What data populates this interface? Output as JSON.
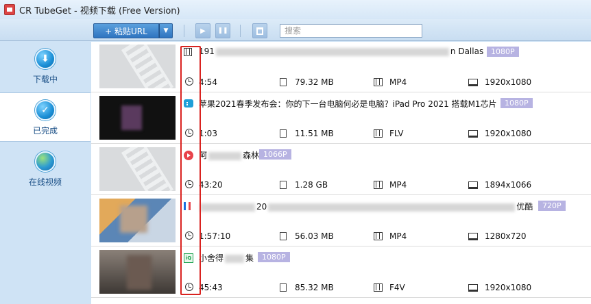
{
  "window": {
    "title": "CR TubeGet - 视频下载 (Free Version)"
  },
  "toolbar": {
    "paste_label": "+ 粘贴URL",
    "dropdown_glyph": "▼",
    "play_glyph": "▶",
    "pause_glyph": "❚❚",
    "search_placeholder": "搜索"
  },
  "sidebar": {
    "items": [
      {
        "label": "下载中",
        "icon": "download-icon"
      },
      {
        "label": "已完成",
        "icon": "check-icon",
        "active": true
      },
      {
        "label": "在线视频",
        "icon": "globe-icon"
      }
    ]
  },
  "videos": [
    {
      "source_icon": "film-icon",
      "title_start": "191",
      "title_end": "n Dallas",
      "quality": "1080P",
      "duration": "4:54",
      "size": "79.32 MB",
      "format": "MP4",
      "resolution": "1920x1080"
    },
    {
      "source_icon": "bilibili-icon",
      "title": "苹果2021春季发布会：你的下一台电脑何必是电脑？iPad Pro 2021 搭载M1芯片",
      "quality": "1080P",
      "duration": "1:03",
      "size": "11.51 MB",
      "format": "FLV",
      "resolution": "1920x1080"
    },
    {
      "source_icon": "red-play-icon",
      "title_start": "阿",
      "title_end": "森林",
      "quality": "1066P",
      "duration": "43:20",
      "size": "1.28 GB",
      "format": "MP4",
      "resolution": "1894x1066"
    },
    {
      "source_icon": "blue-logo-icon",
      "title_start": "",
      "title_mid": "20",
      "title_end": "优酷",
      "quality": "720P",
      "duration": "1:57:10",
      "size": "56.03 MB",
      "format": "MP4",
      "resolution": "1280x720"
    },
    {
      "source_icon": "iqiyi-icon",
      "title_start": "小舍得",
      "title_end": "集",
      "quality": "1080P",
      "duration": "45:43",
      "size": "85.32 MB",
      "format": "F4V",
      "resolution": "1920x1080"
    }
  ],
  "colors": {
    "highlight_border": "#d9221f",
    "badge": "#b7b3e2",
    "sidebar_bg": "#cfe3f5"
  }
}
